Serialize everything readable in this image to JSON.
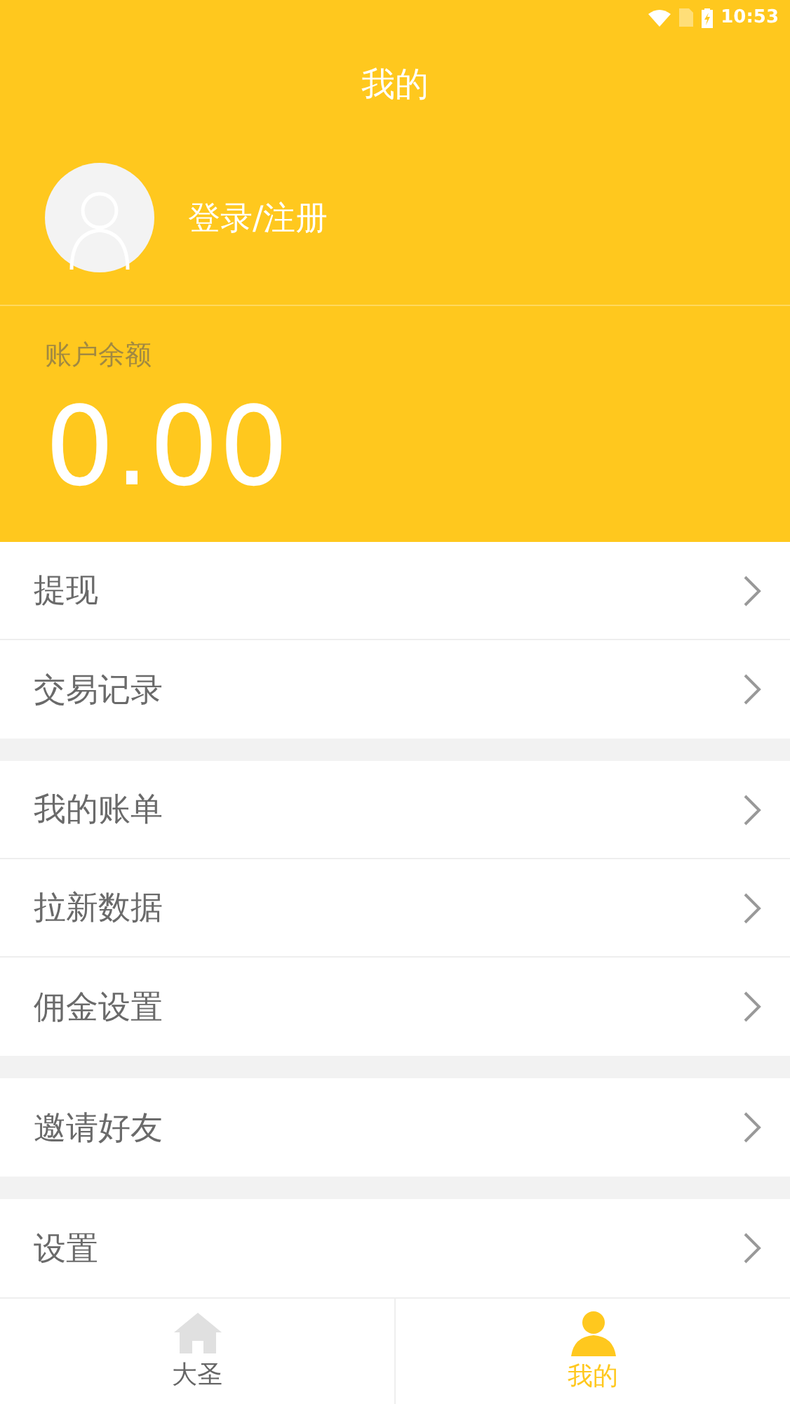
{
  "status_bar": {
    "time": "10:53"
  },
  "header": {
    "title": "我的",
    "login": "登录/注册"
  },
  "balance": {
    "label": "账户余额",
    "amount": "0.00"
  },
  "menu_groups": [
    {
      "items": [
        {
          "label": "提现"
        },
        {
          "label": "交易记录"
        }
      ]
    },
    {
      "items": [
        {
          "label": "我的账单"
        },
        {
          "label": "拉新数据"
        },
        {
          "label": "佣金设置"
        }
      ]
    },
    {
      "items": [
        {
          "label": "邀请好友"
        }
      ]
    },
    {
      "items": [
        {
          "label": "设置"
        }
      ]
    }
  ],
  "tabs": [
    {
      "label": "大圣",
      "kind": "home",
      "selected": false
    },
    {
      "label": "我的",
      "kind": "person",
      "selected": true
    }
  ]
}
